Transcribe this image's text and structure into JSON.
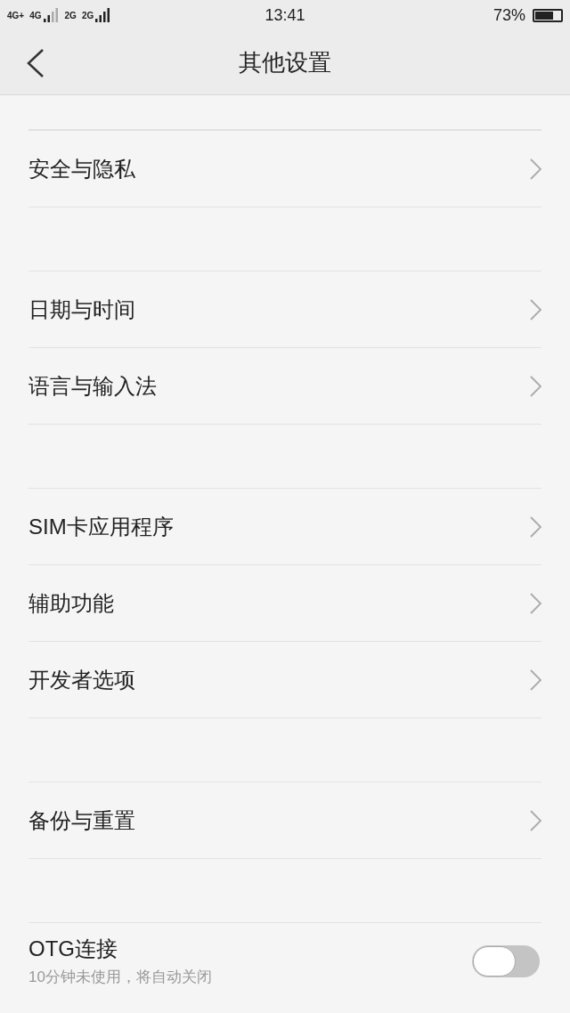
{
  "status_bar": {
    "networks": [
      {
        "label": "4G+"
      },
      {
        "label": "4G"
      },
      {
        "label": "2G"
      },
      {
        "label": "2G"
      }
    ],
    "time": "13:41",
    "battery_text": "73%",
    "battery": {
      "level": 0.73
    }
  },
  "header": {
    "title": "其他设置"
  },
  "groups": [
    {
      "items": [
        {
          "kind": "link",
          "label": "安全与隐私"
        }
      ]
    },
    {
      "items": [
        {
          "kind": "link",
          "label": "日期与时间"
        },
        {
          "kind": "link",
          "label": "语言与输入法"
        }
      ]
    },
    {
      "items": [
        {
          "kind": "link",
          "label": "SIM卡应用程序"
        },
        {
          "kind": "link",
          "label": "辅助功能"
        },
        {
          "kind": "link",
          "label": "开发者选项"
        }
      ]
    },
    {
      "items": [
        {
          "kind": "link",
          "label": "备份与重置"
        }
      ]
    },
    {
      "items": [
        {
          "kind": "toggle",
          "label": "OTG连接",
          "subtitle": "10分钟未使用，将自动关闭",
          "on": false
        }
      ]
    }
  ]
}
